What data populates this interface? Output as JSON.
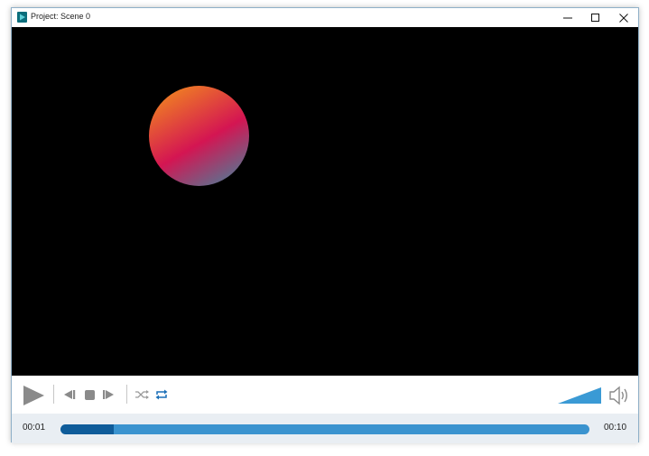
{
  "window": {
    "title": "Project: Scene 0"
  },
  "icons": {
    "app": "app-icon",
    "minimize": "minimize-icon",
    "maximize": "maximize-icon",
    "close": "close-icon",
    "play": "play-icon",
    "step_back": "step-back-icon",
    "stop": "stop-icon",
    "step_forward": "step-forward-icon",
    "shuffle": "shuffle-icon",
    "repeat": "repeat-icon",
    "volume": "speaker-icon"
  },
  "colors": {
    "accent": "#0f5c9a",
    "track": "#3a93cf",
    "volume": "#3a9ad5",
    "control_gray": "#8a8a8a",
    "repeat_active": "#1a6fb8",
    "sphere_top": "#f28a1e",
    "sphere_mid": "#d41552",
    "sphere_bottom": "#3b8aa0"
  },
  "playback": {
    "current_time": "00:01",
    "total_time": "00:10",
    "progress": 0.1,
    "volume": 1.0,
    "repeat_enabled": true,
    "shuffle_enabled": false
  }
}
